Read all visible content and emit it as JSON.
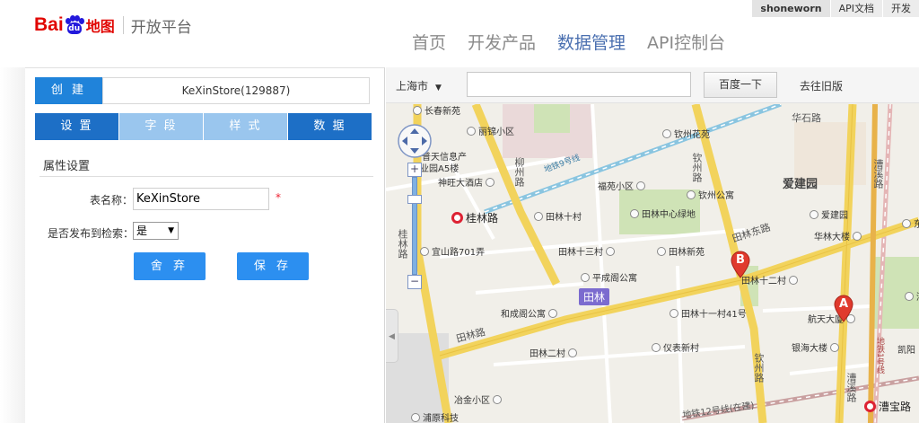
{
  "header": {
    "logo": {
      "bai": "Bai",
      "du": "du",
      "map": "地图",
      "platform": "开放平台"
    },
    "top_links": {
      "user": "shoneworn",
      "api_docs": "API文档",
      "dev": "开发"
    },
    "nav": [
      "首页",
      "开发产品",
      "数据管理",
      "API控制台"
    ],
    "active_nav": "数据管理"
  },
  "panel": {
    "create_label": "创 建",
    "store_name": "KeXinStore(129887)",
    "tabs": [
      "设 置",
      "字 段",
      "样 式",
      "数 据"
    ],
    "section_title": "属性设置",
    "table_name_label": "表名称：",
    "table_name_value": "KeXinStore",
    "required_mark": "*",
    "publish_label": "是否发布到检索：",
    "publish_value": "是",
    "discard_label": "舍 弃",
    "save_label": "保 存"
  },
  "map": {
    "city": "上海市",
    "search_value": "",
    "search_button": "百度一下",
    "old_version": "去往旧版",
    "marker_a": "A",
    "marker_b": "B",
    "tianlin_badge": "田林",
    "metro": {
      "guilin": "桂林路",
      "caobao": "漕宝路"
    },
    "pois": {
      "changchun": "长春新苑",
      "lihua": "丽锦小区",
      "jintian": "普天信息产",
      "jintian2": "业园A5楼",
      "shenwang": "神旺大酒店",
      "tianlin10": "田林十村",
      "fuyuan": "福苑小区",
      "qinzhou_garden": "钦州花苑",
      "tianlin_park": "田林中心绿地",
      "qinzhou_apt": "钦州公寓",
      "aijian": "爱建园",
      "aijian_park": "爱建园",
      "huahua": "华林大楼",
      "dongyu": "东宇",
      "yishan": "宜山路701弄",
      "tianlin13": "田林十三村",
      "tianlin_new": "田林新苑",
      "pingcheng": "平成阁公寓",
      "tianlin12": "田林十二村",
      "caoxi": "漕",
      "hechengge": "和成阁公寓",
      "tianlin11": "田林十一村41号",
      "hangtian": "航天大厦",
      "tianlin2": "田林二村",
      "yibiao": "仪表新村",
      "yinhai": "银海大楼",
      "kaifeng": "凯阳",
      "yejin": "冶金小区",
      "pudian": "浦原科技"
    },
    "roads": {
      "huashi": "华石路",
      "tianlin_east": "田林东路",
      "tianlin_rd": "田林路",
      "qinzhou": "钦州路",
      "qinzhou_s": "钦州路",
      "caoxi_n": "漕溪路",
      "caoxi_s": "漕溪路",
      "guilin_rd": "桂林路",
      "liuzhou": "柳州路",
      "metro9": "地铁9号线",
      "metro1": "地铁1号线",
      "metro12": "地铁12号线(在建)"
    }
  }
}
